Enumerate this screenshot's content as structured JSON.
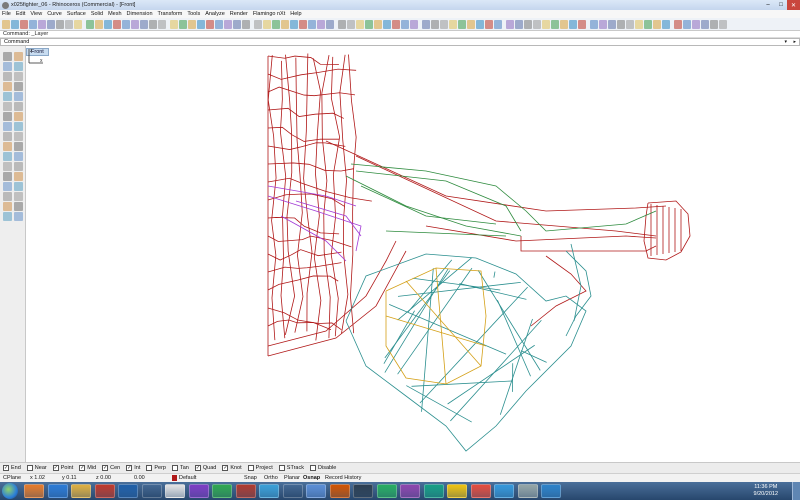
{
  "window": {
    "title": "x025fighter_06 - Rhinoceros (Commercial) - [Front]"
  },
  "menu": [
    "File",
    "Edit",
    "View",
    "Curve",
    "Surface",
    "Solid",
    "Mesh",
    "Dimension",
    "Transform",
    "Tools",
    "Analyze",
    "Render",
    "Flamingo nXt",
    "Help"
  ],
  "command": {
    "history": "Command: _Layer",
    "prompt": "Command"
  },
  "viewport": {
    "tab_label": "Front",
    "axis_z": "z",
    "axis_x": "x"
  },
  "osnaps": [
    {
      "label": "End",
      "checked": true
    },
    {
      "label": "Near",
      "checked": false
    },
    {
      "label": "Point",
      "checked": true
    },
    {
      "label": "Mid",
      "checked": true
    },
    {
      "label": "Cen",
      "checked": true
    },
    {
      "label": "Int",
      "checked": true
    },
    {
      "label": "Perp",
      "checked": false
    },
    {
      "label": "Tan",
      "checked": false
    },
    {
      "label": "Quad",
      "checked": true
    },
    {
      "label": "Knot",
      "checked": true
    },
    {
      "label": "Project",
      "checked": false
    },
    {
      "label": "STrack",
      "checked": false
    },
    {
      "label": "Disable",
      "checked": false
    }
  ],
  "status": {
    "cplane": "CPlane",
    "x": "x 1.02",
    "y": "y 0.11",
    "z": "z 0.00",
    "distance": "0.00",
    "layer": "Default",
    "snap": "Snap",
    "ortho": "Ortho",
    "planar": "Planar",
    "osnap": "Osnap",
    "history": "Record History"
  },
  "clock": {
    "time": "11:36 PM",
    "date": "9/20/2012"
  },
  "colors": {
    "fuselage": "#b01818",
    "green_wire": "#2e8b3e",
    "purple_wire": "#a23bd6",
    "teal_wire": "#2b8f8f",
    "yellow_wire": "#d4a017",
    "layer_swatch": "#b01818"
  }
}
